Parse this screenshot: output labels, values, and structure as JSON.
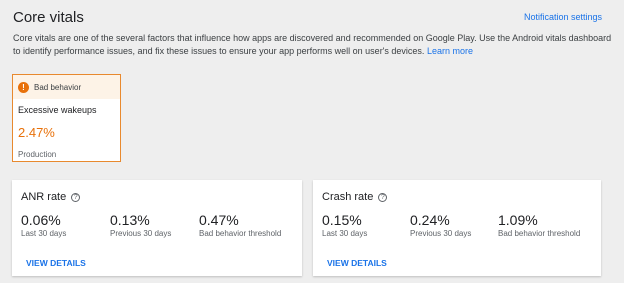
{
  "header": {
    "title": "Core vitals",
    "notification_link": "Notification settings"
  },
  "description": {
    "text": "Core vitals are one of the several factors that influence how apps are discovered and recommended on Google Play. Use the Android vitals dashboard to identify performance issues, and fix these issues to ensure your app performs well on user's devices.",
    "learn_more": "Learn more"
  },
  "bad_behavior_card": {
    "icon": "warning-icon",
    "badge": "Bad behavior",
    "metric": "Excessive wakeups",
    "value": "2.47%",
    "track": "Production",
    "accent_color": "#e8710a"
  },
  "anr_card": {
    "title": "ANR rate",
    "stats": [
      {
        "value": "0.06%",
        "label": "Last 30 days"
      },
      {
        "value": "0.13%",
        "label": "Previous 30 days"
      },
      {
        "value": "0.47%",
        "label": "Bad behavior threshold"
      }
    ],
    "action": "VIEW DETAILS"
  },
  "crash_card": {
    "title": "Crash rate",
    "stats": [
      {
        "value": "0.15%",
        "label": "Last 30 days"
      },
      {
        "value": "0.24%",
        "label": "Previous 30 days"
      },
      {
        "value": "1.09%",
        "label": "Bad behavior threshold"
      }
    ],
    "action": "VIEW DETAILS"
  },
  "colors": {
    "link": "#1a73e8",
    "background": "#eeeeee"
  }
}
